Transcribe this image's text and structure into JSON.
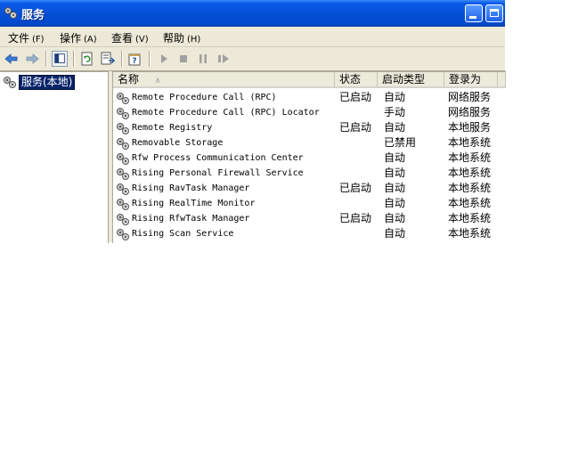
{
  "window": {
    "title": "服务",
    "icon": "gears-icon"
  },
  "menu": [
    {
      "label": "文件",
      "key": "(F)"
    },
    {
      "label": "操作",
      "key": "(A)"
    },
    {
      "label": "查看",
      "key": "(V)"
    },
    {
      "label": "帮助",
      "key": "(H)"
    }
  ],
  "toolbar": {
    "icons": [
      "back-arrow-icon",
      "forward-arrow-icon",
      "show-hide-tree-icon",
      "refresh-icon",
      "export-list-icon",
      "properties-help-icon",
      "start-service-icon",
      "stop-service-icon",
      "pause-service-icon",
      "restart-service-icon"
    ]
  },
  "tree": {
    "selected_label": "服务(本地)"
  },
  "table": {
    "columns": [
      "名称",
      "状态",
      "启动类型",
      "登录为"
    ],
    "sort_indicator": "∧",
    "rows": [
      {
        "name": "Remote Procedure Call (RPC)",
        "status": "已启动",
        "startup": "自动",
        "logon": "网络服务"
      },
      {
        "name": "Remote Procedure Call (RPC) Locator",
        "status": "",
        "startup": "手动",
        "logon": "网络服务"
      },
      {
        "name": "Remote Registry",
        "status": "已启动",
        "startup": "自动",
        "logon": "本地服务"
      },
      {
        "name": "Removable Storage",
        "status": "",
        "startup": "已禁用",
        "logon": "本地系统"
      },
      {
        "name": "Rfw Process Communication Center",
        "status": "",
        "startup": "自动",
        "logon": "本地系统"
      },
      {
        "name": "Rising Personal Firewall Service",
        "status": "",
        "startup": "自动",
        "logon": "本地系统"
      },
      {
        "name": "Rising RavTask Manager",
        "status": "已启动",
        "startup": "自动",
        "logon": "本地系统"
      },
      {
        "name": "Rising RealTime Monitor",
        "status": "",
        "startup": "自动",
        "logon": "本地系统"
      },
      {
        "name": "Rising RfwTask Manager",
        "status": "已启动",
        "startup": "自动",
        "logon": "本地系统"
      },
      {
        "name": "Rising Scan Service",
        "status": "",
        "startup": "自动",
        "logon": "本地系统"
      }
    ]
  },
  "colors": {
    "titlebar": "#0550d8",
    "selection": "#0a246a",
    "chrome": "#ece9d8"
  }
}
